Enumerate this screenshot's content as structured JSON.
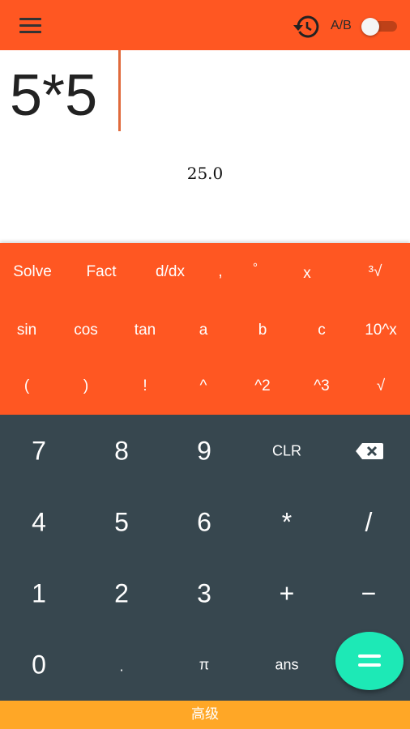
{
  "toolbar": {
    "menu_icon": "hamburger-menu-icon",
    "history_icon": "history-icon",
    "mode_label": "A/B",
    "toggle_on": false
  },
  "display": {
    "expression": "5*5",
    "result": "25.0"
  },
  "advanced_keys": {
    "row1": [
      "Solve",
      "Fact",
      "d/dx",
      ",",
      "°",
      "x",
      "³√"
    ],
    "row2": [
      "sin",
      "cos",
      "tan",
      "a",
      "b",
      "c",
      "10^x"
    ],
    "row3": [
      "(",
      ")",
      "!",
      "^",
      "^2",
      "^3",
      "√"
    ]
  },
  "keypad": {
    "row1": [
      "7",
      "8",
      "9",
      "CLR"
    ],
    "backspace_icon": "backspace-icon",
    "row2": [
      "4",
      "5",
      "6",
      "*",
      "/"
    ],
    "row3": [
      "1",
      "2",
      "3",
      "+",
      "−"
    ],
    "row4": [
      "0",
      ".",
      "π",
      "ans"
    ],
    "equals_icon": "equals-icon"
  },
  "bottom_bar": {
    "label": "高级"
  },
  "colors": {
    "primary": "#FF5722",
    "keypad_bg": "#37474F",
    "accent": "#1DE9B6",
    "bottom_bar": "#FFA726"
  }
}
